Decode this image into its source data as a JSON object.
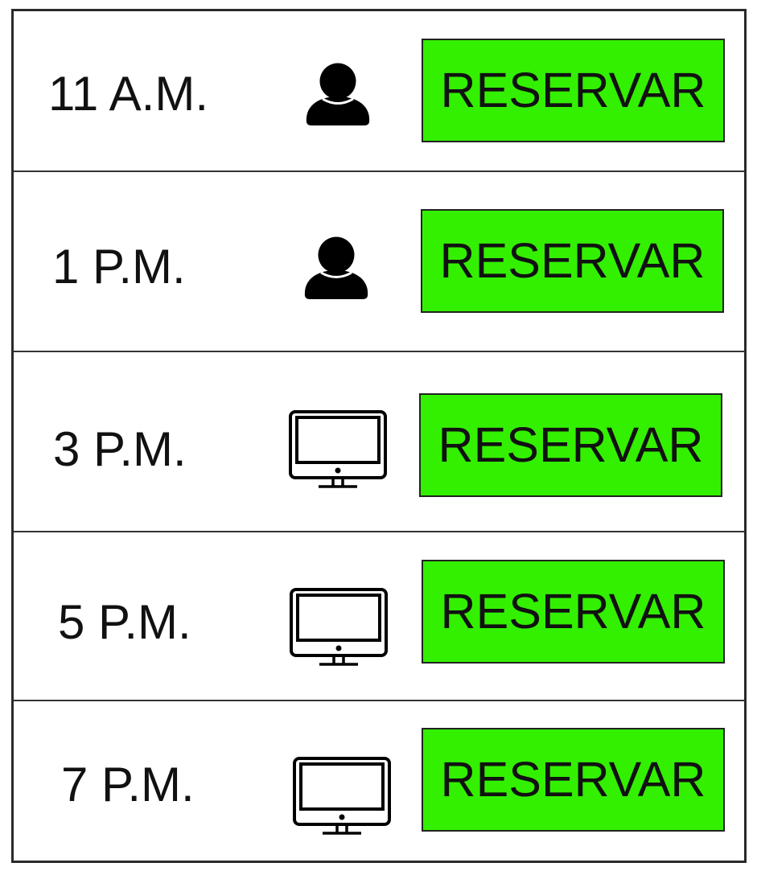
{
  "accent_color": "#33f000",
  "slots": [
    {
      "time": "11 A.M.",
      "icon": "person-icon",
      "button_label": "RESERVAR"
    },
    {
      "time": "1 P.M.",
      "icon": "person-icon",
      "button_label": "RESERVAR"
    },
    {
      "time": "3 P.M.",
      "icon": "monitor-icon",
      "button_label": "RESERVAR"
    },
    {
      "time": "5 P.M.",
      "icon": "monitor-icon",
      "button_label": "RESERVAR"
    },
    {
      "time": "7 P.M.",
      "icon": "monitor-icon",
      "button_label": "RESERVAR"
    }
  ]
}
